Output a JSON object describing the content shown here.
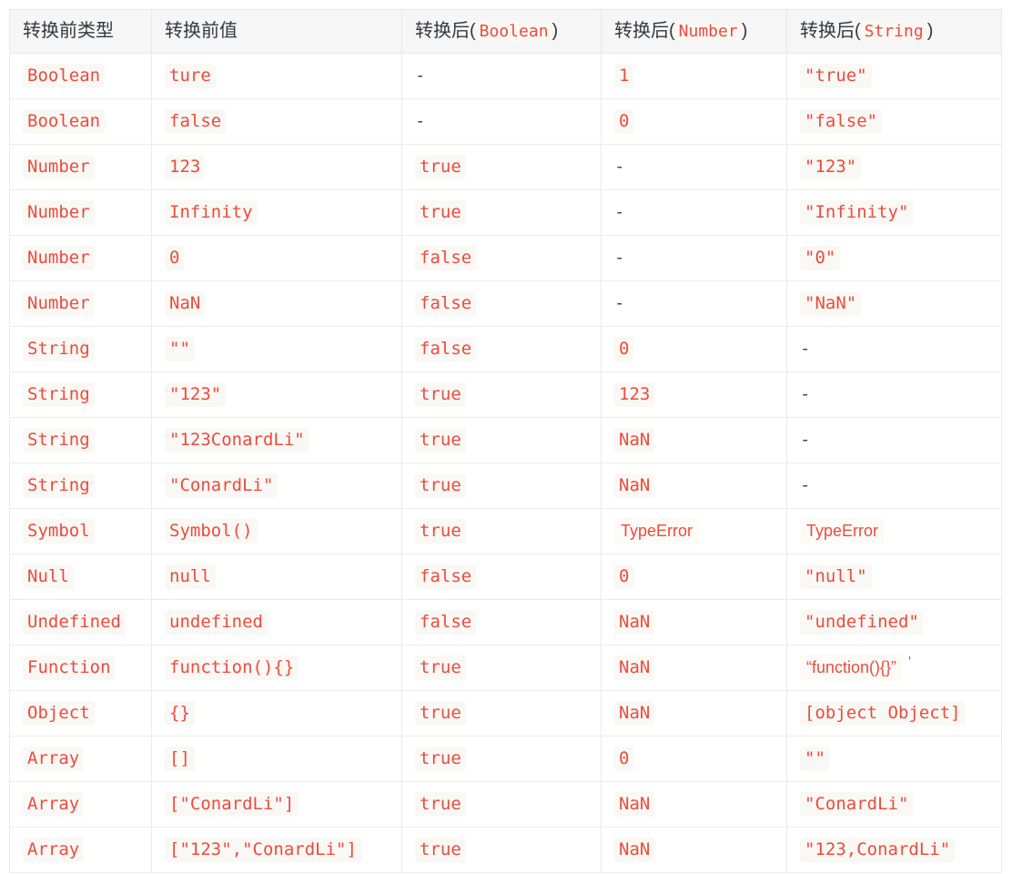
{
  "table": {
    "headers": [
      {
        "prefix": "转换前类型",
        "code": "",
        "suffix": ""
      },
      {
        "prefix": "转换前值",
        "code": "",
        "suffix": ""
      },
      {
        "prefix": "转换后(",
        "code": "Boolean",
        "suffix": ")"
      },
      {
        "prefix": "转换后(",
        "code": "Number",
        "suffix": ")"
      },
      {
        "prefix": "转换后(",
        "code": "String",
        "suffix": ")"
      }
    ],
    "rows": [
      {
        "type": "Boolean",
        "value": "ture",
        "boolean": "-",
        "number": "1",
        "string": "\"true\""
      },
      {
        "type": "Boolean",
        "value": "false",
        "boolean": "-",
        "number": "0",
        "string": "\"false\""
      },
      {
        "type": "Number",
        "value": "123",
        "boolean": "true",
        "number": "-",
        "string": "\"123\""
      },
      {
        "type": "Number",
        "value": "Infinity",
        "boolean": "true",
        "number": "-",
        "string": "\"Infinity\""
      },
      {
        "type": "Number",
        "value": "0",
        "boolean": "false",
        "number": "-",
        "string": "\"0\""
      },
      {
        "type": "Number",
        "value": "NaN",
        "boolean": "false",
        "number": "-",
        "string": "\"NaN\""
      },
      {
        "type": "String",
        "value": "\"\"",
        "boolean": "false",
        "number": "0",
        "string": "-"
      },
      {
        "type": "String",
        "value": "\"123\"",
        "boolean": "true",
        "number": "123",
        "string": "-"
      },
      {
        "type": "String",
        "value": "\"123ConardLi\"",
        "boolean": "true",
        "number": "NaN",
        "string": "-"
      },
      {
        "type": "String",
        "value": "\"ConardLi\"",
        "boolean": "true",
        "number": "NaN",
        "string": "-"
      },
      {
        "type": "Symbol",
        "value": "Symbol()",
        "boolean": "true",
        "number": "TypeError",
        "string": "TypeError"
      },
      {
        "type": "Null",
        "value": "null",
        "boolean": "false",
        "number": "0",
        "string": "\"null\""
      },
      {
        "type": "Undefined",
        "value": "undefined",
        "boolean": "false",
        "number": "NaN",
        "string": "\"undefined\""
      },
      {
        "type": "Function",
        "value": "function(){}",
        "boolean": "true",
        "number": "NaN",
        "string": "“function(){}”",
        "string_trailing": "'"
      },
      {
        "type": "Object",
        "value": "{}",
        "boolean": "true",
        "number": "NaN",
        "string": "[object Object]"
      },
      {
        "type": "Array",
        "value": "[]",
        "boolean": "true",
        "number": "0",
        "string": "\"\""
      },
      {
        "type": "Array",
        "value": "[\"ConardLi\"]",
        "boolean": "true",
        "number": "NaN",
        "string": "\"ConardLi\""
      },
      {
        "type": "Array",
        "value": "[\"123\",\"ConardLi\"]",
        "boolean": "true",
        "number": "NaN",
        "string": "\"123,ConardLi\""
      }
    ]
  },
  "colors": {
    "code_red": "#ea4c3e",
    "code_bg": "#faf8f4",
    "header_bg": "#f6f6f6",
    "border": "#ebebeb",
    "text": "#34393e"
  }
}
